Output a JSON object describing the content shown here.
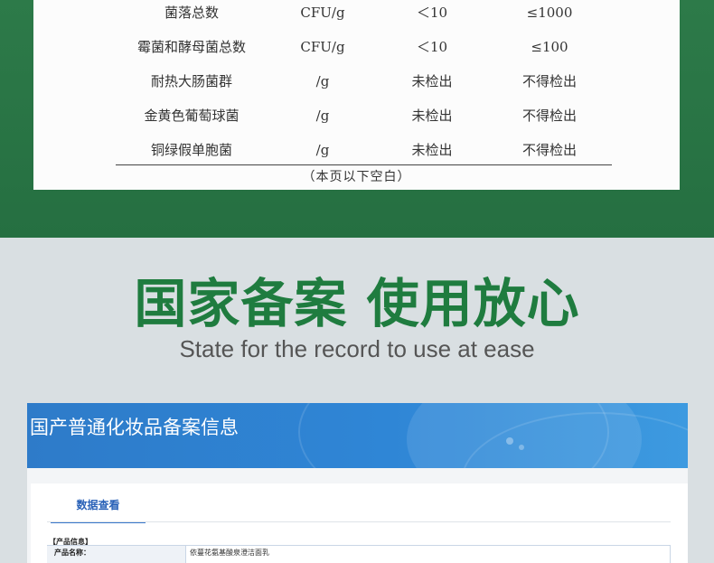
{
  "report": {
    "rows": [
      {
        "item": "菌落总数",
        "unit": "CFU/g",
        "result": "＜10",
        "limit": "≤1000"
      },
      {
        "item": "霉菌和酵母菌总数",
        "unit": "CFU/g",
        "result": "＜10",
        "limit": "≤100"
      },
      {
        "item": "耐热大肠菌群",
        "unit": "/g",
        "result": "未检出",
        "limit": "不得检出"
      },
      {
        "item": "金黄色葡萄球菌",
        "unit": "/g",
        "result": "未检出",
        "limit": "不得检出"
      },
      {
        "item": "铜绿假单胞菌",
        "unit": "/g",
        "result": "未检出",
        "limit": "不得检出"
      }
    ],
    "note": "（本页以下空白）"
  },
  "headline": {
    "title": "国家备案 使用放心",
    "subtitle": "State for the record to use at ease"
  },
  "registration": {
    "banner_title": "国产普通化妆品备案信息",
    "tab_label": "数据查看",
    "section_label": "【产品信息】",
    "field_label": "产品名称：",
    "field_value": "依蔓花氨基酸泉澄洁面乳"
  },
  "colors": {
    "band_green": "#2d7a49",
    "headline_green": "#1f7c3f",
    "banner_blue": "#2f86d6"
  }
}
